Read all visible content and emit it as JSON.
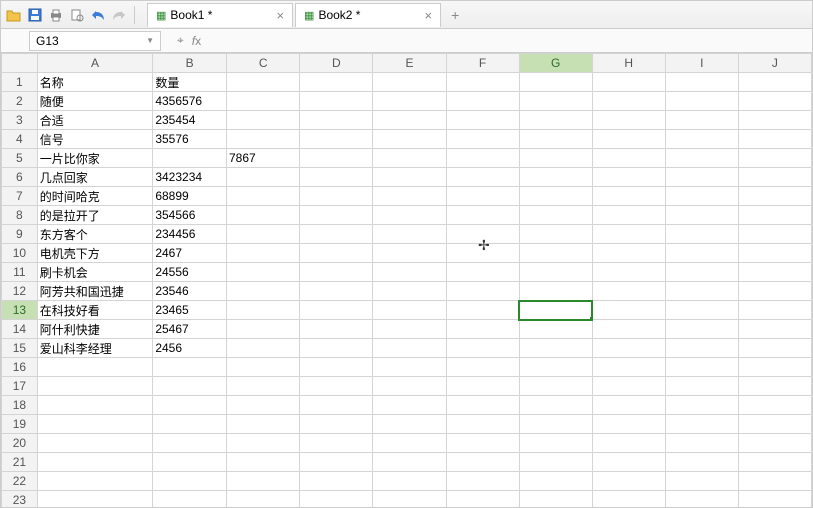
{
  "toolbar": {
    "open": "open-icon",
    "save": "save-icon",
    "print": "print-icon",
    "printpreview": "print-preview-icon",
    "undo": "undo-icon",
    "redo": "redo-icon"
  },
  "tabs": [
    {
      "label": "Book1 *"
    },
    {
      "label": "Book2 *"
    }
  ],
  "nameBox": "G13",
  "formula": "",
  "columns": [
    "A",
    "B",
    "C",
    "D",
    "E",
    "F",
    "G",
    "H",
    "I",
    "J"
  ],
  "selectedCell": {
    "row": 13,
    "col": "G"
  },
  "rows": [
    {
      "n": 1,
      "A": "名称",
      "B": "数量"
    },
    {
      "n": 2,
      "A": "随便",
      "B": "4356576"
    },
    {
      "n": 3,
      "A": "合适",
      "B": "235454"
    },
    {
      "n": 4,
      "A": "信号",
      "B": "35576"
    },
    {
      "n": 5,
      "A": "一片比你家",
      "C": "7867"
    },
    {
      "n": 6,
      "A": "几点回家",
      "B": "3423234"
    },
    {
      "n": 7,
      "A": "的时间哈克",
      "B": "68899"
    },
    {
      "n": 8,
      "A": "的是拉开了",
      "B": "354566"
    },
    {
      "n": 9,
      "A": "东方客个",
      "B": "234456"
    },
    {
      "n": 10,
      "A": "电机壳下方",
      "B": "2467"
    },
    {
      "n": 11,
      "A": "刷卡机会",
      "B": "24556"
    },
    {
      "n": 12,
      "A": "阿芳共和国迅捷",
      "B": "23546"
    },
    {
      "n": 13,
      "A": "在科技好看",
      "B": "23465"
    },
    {
      "n": 14,
      "A": "阿什利快捷",
      "B": "25467"
    },
    {
      "n": 15,
      "A": "爱山科李经理",
      "B": "2456"
    },
    {
      "n": 16
    },
    {
      "n": 17
    },
    {
      "n": 18
    },
    {
      "n": 19
    },
    {
      "n": 20
    },
    {
      "n": 21
    },
    {
      "n": 22
    },
    {
      "n": 23
    }
  ]
}
